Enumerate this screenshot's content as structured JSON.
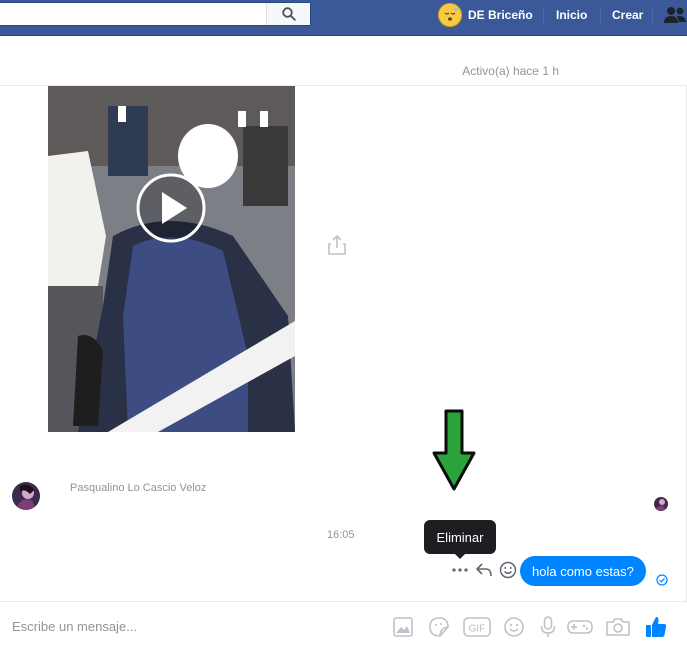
{
  "header": {
    "search_placeholder": "",
    "user_name": "DE Briceño",
    "nav_inicio": "Inicio",
    "nav_crear": "Crear"
  },
  "conversation": {
    "active_status": "Activo(a) hace 1 h",
    "sender_name": "Pasqualino Lo Cascio Veloz",
    "time": "16:05",
    "tooltip": "Eliminar",
    "my_message": "hola como estas?"
  },
  "composer": {
    "placeholder": "Escribe un mensaje...",
    "gif_label": "GIF"
  },
  "colors": {
    "topbar": "#3b5998",
    "bubble": "#0084ff",
    "arrow": "#2aa33b",
    "tooltip": "#1c1e21"
  }
}
